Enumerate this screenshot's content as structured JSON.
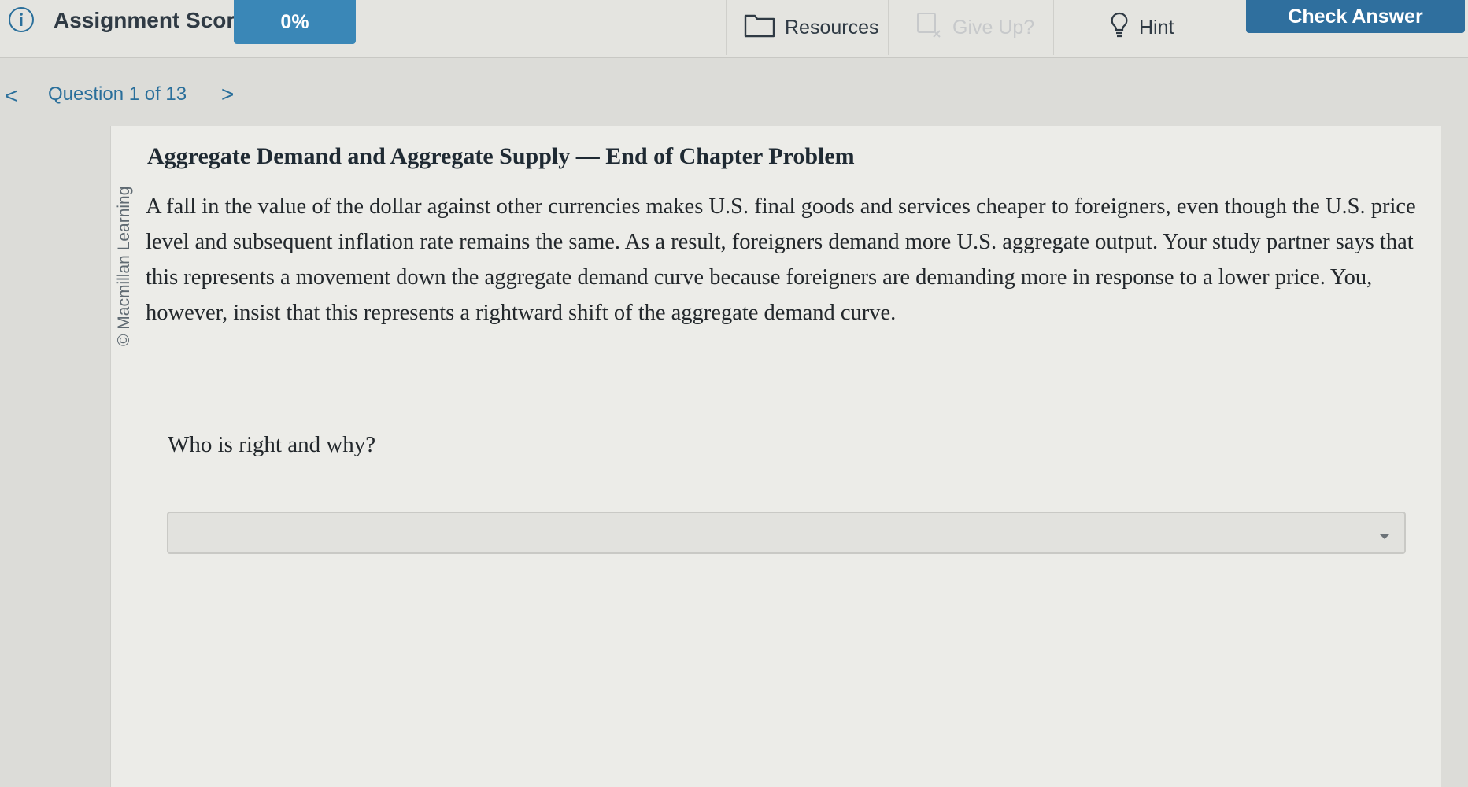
{
  "header": {
    "score_label": "Assignment Score:",
    "score_value": "0%",
    "resources_label": "Resources",
    "giveup_label": "Give Up?",
    "hint_label": "Hint",
    "check_label": "Check Answer"
  },
  "nav": {
    "question_label": "Question 1 of 13",
    "prev_glyph": "<",
    "next_glyph": ">"
  },
  "question": {
    "watermark": "© Macmillan Learning",
    "title": "Aggregate Demand and Aggregate Supply — End of Chapter Problem",
    "body": "A fall in the value of the dollar against other currencies makes U.S. final goods and services cheaper to foreigners, even though the U.S. price level and subsequent inflation rate remains the same. As a result, foreigners demand more U.S. aggregate output. Your study partner says that this represents a movement down the aggregate demand curve because foreigners are demanding more in response to a lower price. You, however, insist that this represents a rightward shift of the aggregate demand curve.",
    "prompt": "Who is right and why?",
    "answer_selected": ""
  },
  "icons": {
    "info": "info-icon",
    "resources": "folder-icon",
    "giveup": "give-up-icon",
    "hint": "lightbulb-icon",
    "dropdown": "chevron-down-icon"
  },
  "colors": {
    "score_badge": "#3a87b7",
    "check_button": "#2f6f9e",
    "nav_link": "#2a6f9b"
  }
}
